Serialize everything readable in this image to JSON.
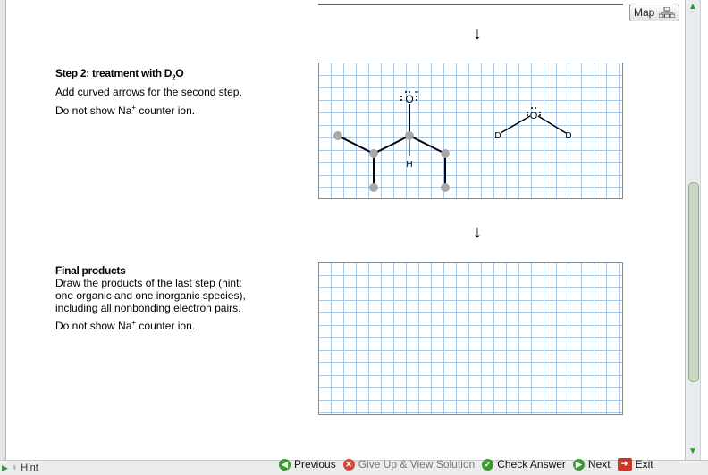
{
  "map_button": {
    "label": "Map"
  },
  "step2": {
    "title_pre": "Step 2: treatment with D",
    "title_sub": "2",
    "title_post": "O",
    "line1": "Add curved arrows for the second step.",
    "line2_pre": "Do not show Na",
    "line2_sup": "+",
    "line2_post": " counter ion."
  },
  "final": {
    "title": "Final products",
    "line1": "Draw the products of the last step (hint:",
    "line2": "one organic and one inorganic species),",
    "line3": "including all nonbonding electron pairs.",
    "line4_pre": "Do not show Na",
    "line4_sup": "+",
    "line4_post": " counter ion."
  },
  "arrows": {
    "symbol": "↓"
  },
  "molecule": {
    "oxygen_label": "O",
    "hydrogen_label": "H",
    "d_left": "D",
    "d_right": "D",
    "water_oxygen": "O"
  },
  "hint": {
    "label": "Hint"
  },
  "toolbar": {
    "previous": "Previous",
    "give_up": "Give Up & View Solution",
    "check": "Check Answer",
    "next": "Next",
    "exit": "Exit"
  },
  "colors": {
    "grid_line": "#a8c8e8",
    "green_icon": "#3a9a2e",
    "red_icon": "#d24a38"
  }
}
